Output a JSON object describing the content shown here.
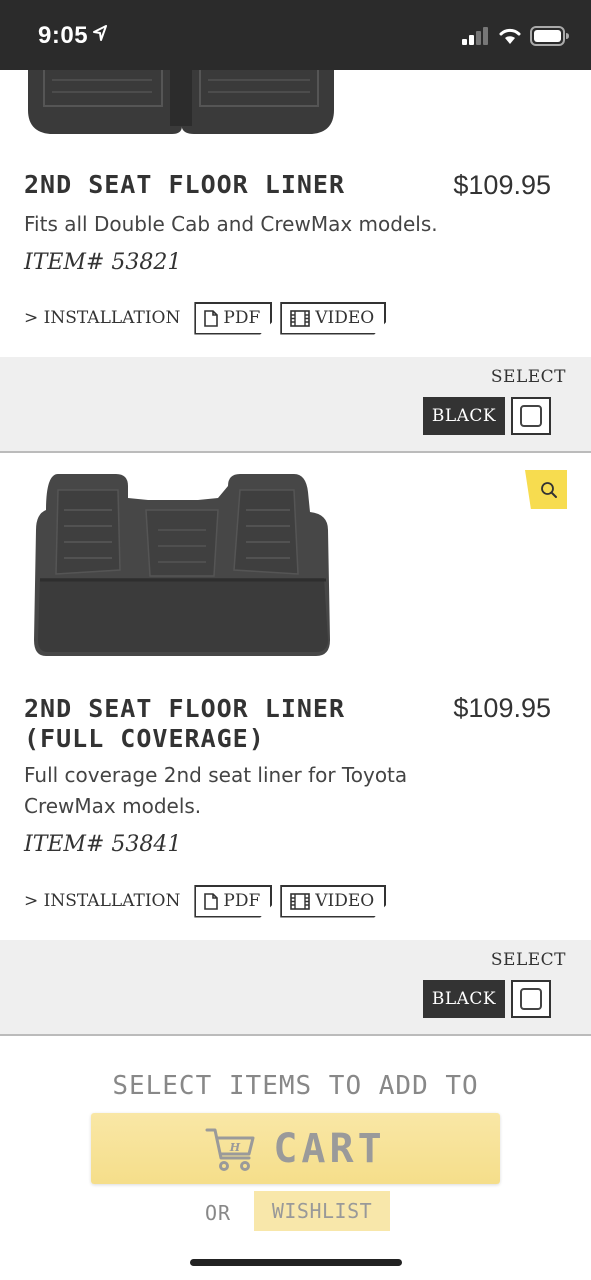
{
  "status_bar": {
    "time": "9:05"
  },
  "products": [
    {
      "title": "2ND SEAT FLOOR LINER",
      "price": "$109.95",
      "description": "Fits all Double Cab and CrewMax models.",
      "item_number": "ITEM# 53821",
      "installation_label": "> INSTALLATION",
      "pdf_label": "PDF",
      "video_label": "VIDEO",
      "select_label": "SELECT",
      "color_option": "BLACK"
    },
    {
      "title_line1": "2ND SEAT FLOOR LINER",
      "title_line2": "(FULL COVERAGE)",
      "price": "$109.95",
      "description": "Full coverage 2nd seat liner for Toyota CrewMax models.",
      "item_number": "ITEM# 53841",
      "installation_label": "> INSTALLATION",
      "pdf_label": "PDF",
      "video_label": "VIDEO",
      "select_label": "SELECT",
      "color_option": "BLACK"
    }
  ],
  "cart": {
    "prompt": "SELECT ITEMS TO ADD TO",
    "cart_label": "CART",
    "or_label": "OR",
    "wishlist_label": "WISHLIST"
  },
  "colors": {
    "accent_yellow": "#f7dc4f",
    "cart_button": "#f7e297",
    "dark": "#333333",
    "band": "#efefef"
  }
}
